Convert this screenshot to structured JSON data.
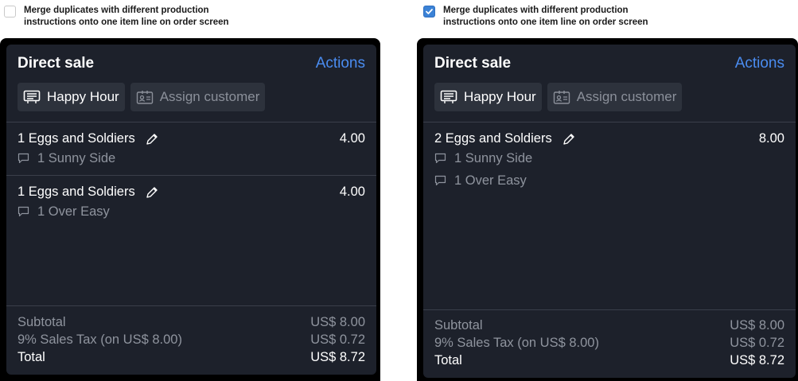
{
  "left": {
    "option_label": "Merge duplicates with different production instructions onto one item line on order screen",
    "option_checked": false,
    "title": "Direct sale",
    "actions": "Actions",
    "tags": [
      "Happy Hour",
      "Assign customer"
    ],
    "items": [
      {
        "qty": "1",
        "name": "Eggs and Soldiers",
        "price": "4.00",
        "instructions": [
          {
            "qty": "1",
            "text": "Sunny Side"
          }
        ]
      },
      {
        "qty": "1",
        "name": "Eggs and Soldiers",
        "price": "4.00",
        "instructions": [
          {
            "qty": "1",
            "text": "Over Easy"
          }
        ]
      }
    ],
    "totals": [
      {
        "label": "Subtotal",
        "value": "US$ 8.00"
      },
      {
        "label": "9% Sales Tax (on US$ 8.00)",
        "value": "US$ 0.72"
      },
      {
        "label": "Total",
        "value": "US$ 8.72"
      }
    ]
  },
  "right": {
    "option_label": "Merge duplicates with different production instructions onto one item line on order screen",
    "option_checked": true,
    "title": "Direct sale",
    "actions": "Actions",
    "tags": [
      "Happy Hour",
      "Assign customer"
    ],
    "items": [
      {
        "qty": "2",
        "name": "Eggs and Soldiers",
        "price": "8.00",
        "instructions": [
          {
            "qty": "1",
            "text": "Sunny Side"
          },
          {
            "qty": "1",
            "text": "Over Easy"
          }
        ]
      }
    ],
    "totals": [
      {
        "label": "Subtotal",
        "value": "US$ 8.00"
      },
      {
        "label": "9% Sales Tax (on US$ 8.00)",
        "value": "US$ 0.72"
      },
      {
        "label": "Total",
        "value": "US$ 8.72"
      }
    ]
  },
  "colors": {
    "panel": "#1d212b",
    "accent": "#4a8cf0",
    "checkbox": "#3b82d6"
  },
  "icons": [
    "receipt-icon",
    "contact-card-icon",
    "pencil-icon",
    "comment-icon",
    "checkmark-icon"
  ]
}
